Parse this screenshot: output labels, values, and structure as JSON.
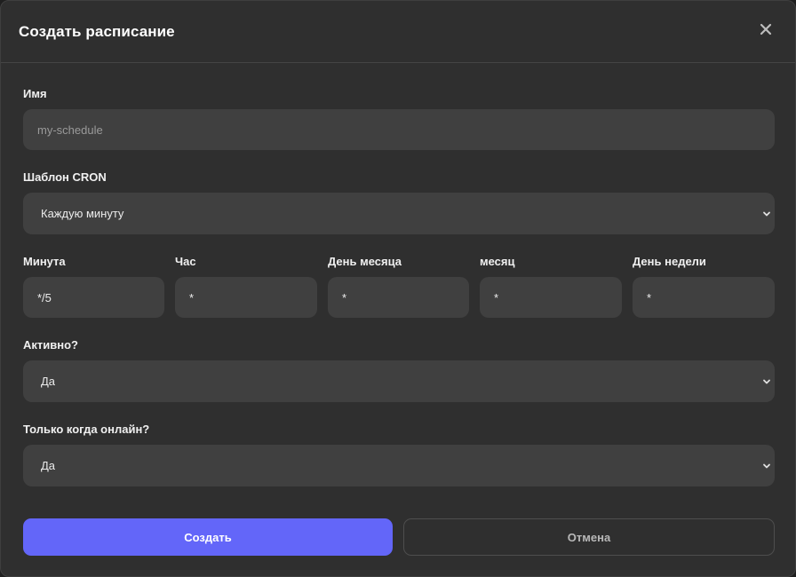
{
  "dialog": {
    "title": "Создать расписание",
    "close_icon": "close-icon"
  },
  "form": {
    "name": {
      "label": "Имя",
      "placeholder": "my-schedule",
      "value": ""
    },
    "cron_template": {
      "label": "Шаблон CRON",
      "selected": "Каждую минуту"
    },
    "cron_fields": [
      {
        "label": "Минута",
        "value": "*/5"
      },
      {
        "label": "Час",
        "value": "*"
      },
      {
        "label": "День месяца",
        "value": "*"
      },
      {
        "label": "месяц",
        "value": "*"
      },
      {
        "label": "День недели",
        "value": "*"
      }
    ],
    "active": {
      "label": "Активно?",
      "selected": "Да"
    },
    "online_only": {
      "label": "Только когда онлайн?",
      "selected": "Да"
    }
  },
  "actions": {
    "create_label": "Создать",
    "cancel_label": "Отмена"
  },
  "colors": {
    "dialog_bg": "#2f2f2f",
    "field_bg": "#404040",
    "accent": "#6366f9"
  }
}
